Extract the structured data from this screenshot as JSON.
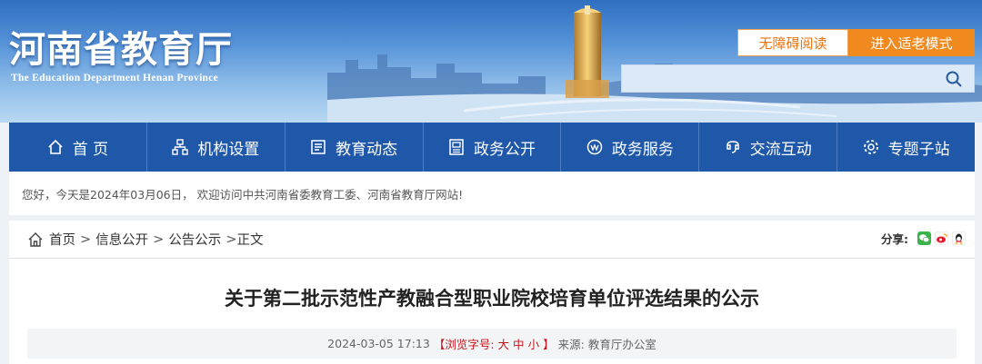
{
  "header": {
    "title": "河南省教育厅",
    "subtitle": "The Education Department Henan Province",
    "accessibility_label": "无障碍阅读",
    "elder_mode_label": "进入适老模式",
    "search_placeholder": ""
  },
  "nav": {
    "items": [
      {
        "label": "首 页",
        "icon": "home-icon"
      },
      {
        "label": "机构设置",
        "icon": "org-chart-icon"
      },
      {
        "label": "教育动态",
        "icon": "news-icon"
      },
      {
        "label": "政务公开",
        "icon": "document-icon"
      },
      {
        "label": "政务服务",
        "icon": "service-icon"
      },
      {
        "label": "交流互动",
        "icon": "interaction-icon"
      },
      {
        "label": "专题子站",
        "icon": "gear-icon"
      }
    ]
  },
  "welcome": {
    "text": "您好，今天是2024年03月06日， 欢迎访问中共河南省委教育工委、河南省教育厅网站!"
  },
  "breadcrumb": {
    "items": [
      "首页",
      "信息公开",
      "公告公示"
    ],
    "current": "正文",
    "separator": ">"
  },
  "share": {
    "label": "分享:",
    "targets": [
      {
        "name": "wechat-icon",
        "color": "#3bb34a"
      },
      {
        "name": "weibo-icon",
        "color": "#e6162d"
      },
      {
        "name": "qq-icon",
        "color": "#1b8fd1"
      }
    ]
  },
  "article": {
    "title": "关于第二批示范性产教融合型职业院校培育单位评选结果的公示",
    "date": "2024-03-05 17:13",
    "font_size_prefix": "【浏览字号:",
    "font_large": "大",
    "font_medium": "中",
    "font_small": "小",
    "font_size_suffix": "】",
    "source_label": "来源:",
    "source": "教育厅办公室"
  },
  "colors": {
    "nav_bg": "#1f58a8",
    "elder_btn": "#f08a1e",
    "accent_red": "#c5161d"
  }
}
